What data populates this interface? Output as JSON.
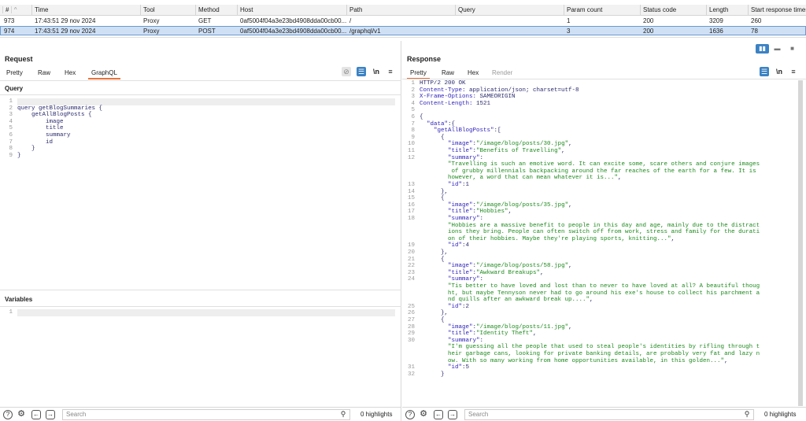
{
  "history": {
    "headers": [
      "#",
      "Time",
      "Tool",
      "Method",
      "Host",
      "Path",
      "Query",
      "Param count",
      "Status code",
      "Length",
      "Start response timer"
    ],
    "sort_indicator": "^",
    "rows": [
      {
        "num": "973",
        "time": "17:43:51 29 nov 2024",
        "tool": "Proxy",
        "method": "GET",
        "host": "0af5004f04a3e23bd4908dda00cb00...",
        "path": "/",
        "query": "",
        "params": "1",
        "status": "200",
        "length": "3209",
        "timer": "260"
      },
      {
        "num": "974",
        "time": "17:43:51 29 nov 2024",
        "tool": "Proxy",
        "method": "POST",
        "host": "0af5004f04a3e23bd4908dda00cb00...",
        "path": "/graphql/v1",
        "query": "",
        "params": "3",
        "status": "200",
        "length": "1636",
        "timer": "78"
      }
    ]
  },
  "request": {
    "title": "Request",
    "tabs": [
      "Pretty",
      "Raw",
      "Hex",
      "GraphQL"
    ],
    "active_tab": "GraphQL",
    "newline_label": "\\n",
    "query_label": "Query",
    "query_lines": [
      "",
      "query getBlogSummaries {",
      "    getAllBlogPosts {",
      "        image",
      "        title",
      "        summary",
      "        id",
      "    }",
      "}"
    ],
    "variables_label": "Variables",
    "variables_lines": [
      ""
    ]
  },
  "response": {
    "title": "Response",
    "tabs": [
      "Pretty",
      "Raw",
      "Hex",
      "Render"
    ],
    "active_tab": "Pretty",
    "newline_label": "\\n",
    "lines": [
      {
        "n": "1",
        "parts": [
          [
            "plain",
            "HTTP/2 200 OK"
          ]
        ]
      },
      {
        "n": "2",
        "parts": [
          [
            "key",
            "Content-Type: "
          ],
          [
            "plain",
            "application/json; charset=utf-8"
          ]
        ]
      },
      {
        "n": "3",
        "parts": [
          [
            "key",
            "X-Frame-Options: "
          ],
          [
            "plain",
            "SAMEORIGIN"
          ]
        ]
      },
      {
        "n": "4",
        "parts": [
          [
            "key",
            "Content-Length: "
          ],
          [
            "plain",
            "1521"
          ]
        ]
      },
      {
        "n": "5",
        "parts": [
          [
            "plain",
            ""
          ]
        ]
      },
      {
        "n": "6",
        "parts": [
          [
            "plain",
            "{"
          ]
        ]
      },
      {
        "n": "7",
        "parts": [
          [
            "plain",
            "  "
          ],
          [
            "key",
            "\"data\""
          ],
          [
            "plain",
            ":{"
          ]
        ]
      },
      {
        "n": "8",
        "parts": [
          [
            "plain",
            "    "
          ],
          [
            "key",
            "\"getAllBlogPosts\""
          ],
          [
            "plain",
            ":["
          ]
        ]
      },
      {
        "n": "9",
        "parts": [
          [
            "plain",
            "      {"
          ]
        ]
      },
      {
        "n": "10",
        "parts": [
          [
            "plain",
            "        "
          ],
          [
            "key",
            "\"image\""
          ],
          [
            "plain",
            ":"
          ],
          [
            "str",
            "\"/image/blog/posts/30.jpg\""
          ],
          [
            "plain",
            ","
          ]
        ]
      },
      {
        "n": "11",
        "parts": [
          [
            "plain",
            "        "
          ],
          [
            "key",
            "\"title\""
          ],
          [
            "plain",
            ":"
          ],
          [
            "str",
            "\"Benefits of Travelling\""
          ],
          [
            "plain",
            ","
          ]
        ]
      },
      {
        "n": "12",
        "parts": [
          [
            "plain",
            "        "
          ],
          [
            "key",
            "\"summary\""
          ],
          [
            "plain",
            ":"
          ]
        ]
      },
      {
        "n": "",
        "parts": [
          [
            "str",
            "        \"Travelling is such an emotive word. It can excite some, scare others and conjure images"
          ]
        ]
      },
      {
        "n": "",
        "parts": [
          [
            "str",
            "         of grubby millennials backpacking around the far reaches of the earth for a few. It is"
          ]
        ]
      },
      {
        "n": "",
        "parts": [
          [
            "str",
            "        however, a word that can mean whatever it is...\""
          ],
          [
            "plain",
            ","
          ]
        ]
      },
      {
        "n": "13",
        "parts": [
          [
            "plain",
            "        "
          ],
          [
            "key",
            "\"id\""
          ],
          [
            "plain",
            ":1"
          ]
        ]
      },
      {
        "n": "14",
        "parts": [
          [
            "plain",
            "      },"
          ]
        ]
      },
      {
        "n": "15",
        "parts": [
          [
            "plain",
            "      {"
          ]
        ]
      },
      {
        "n": "16",
        "parts": [
          [
            "plain",
            "        "
          ],
          [
            "key",
            "\"image\""
          ],
          [
            "plain",
            ":"
          ],
          [
            "str",
            "\"/image/blog/posts/35.jpg\""
          ],
          [
            "plain",
            ","
          ]
        ]
      },
      {
        "n": "17",
        "parts": [
          [
            "plain",
            "        "
          ],
          [
            "key",
            "\"title\""
          ],
          [
            "plain",
            ":"
          ],
          [
            "str",
            "\"Hobbies\""
          ],
          [
            "plain",
            ","
          ]
        ]
      },
      {
        "n": "18",
        "parts": [
          [
            "plain",
            "        "
          ],
          [
            "key",
            "\"summary\""
          ],
          [
            "plain",
            ":"
          ]
        ]
      },
      {
        "n": "",
        "parts": [
          [
            "str",
            "        \"Hobbies are a massive benefit to people in this day and age, mainly due to the distract"
          ]
        ]
      },
      {
        "n": "",
        "parts": [
          [
            "str",
            "        ions they bring. People can often switch off from work, stress and family for the durati"
          ]
        ]
      },
      {
        "n": "",
        "parts": [
          [
            "str",
            "        on of their hobbies. Maybe they're playing sports, knitting...\""
          ],
          [
            "plain",
            ","
          ]
        ]
      },
      {
        "n": "19",
        "parts": [
          [
            "plain",
            "        "
          ],
          [
            "key",
            "\"id\""
          ],
          [
            "plain",
            ":4"
          ]
        ]
      },
      {
        "n": "20",
        "parts": [
          [
            "plain",
            "      },"
          ]
        ]
      },
      {
        "n": "21",
        "parts": [
          [
            "plain",
            "      {"
          ]
        ]
      },
      {
        "n": "22",
        "parts": [
          [
            "plain",
            "        "
          ],
          [
            "key",
            "\"image\""
          ],
          [
            "plain",
            ":"
          ],
          [
            "str",
            "\"/image/blog/posts/58.jpg\""
          ],
          [
            "plain",
            ","
          ]
        ]
      },
      {
        "n": "23",
        "parts": [
          [
            "plain",
            "        "
          ],
          [
            "key",
            "\"title\""
          ],
          [
            "plain",
            ":"
          ],
          [
            "str",
            "\"Awkward Breakups\""
          ],
          [
            "plain",
            ","
          ]
        ]
      },
      {
        "n": "24",
        "parts": [
          [
            "plain",
            "        "
          ],
          [
            "key",
            "\"summary\""
          ],
          [
            "plain",
            ":"
          ]
        ]
      },
      {
        "n": "",
        "parts": [
          [
            "str",
            "        \"Tis better to have loved and lost than to never to have loved at all? A beautiful thoug"
          ]
        ]
      },
      {
        "n": "",
        "parts": [
          [
            "str",
            "        ht, but maybe Tennyson never had to go around his exe's house to collect his parchment a"
          ]
        ]
      },
      {
        "n": "",
        "parts": [
          [
            "str",
            "        nd quills after an awkward break up....\""
          ],
          [
            "plain",
            ","
          ]
        ]
      },
      {
        "n": "25",
        "parts": [
          [
            "plain",
            "        "
          ],
          [
            "key",
            "\"id\""
          ],
          [
            "plain",
            ":2"
          ]
        ]
      },
      {
        "n": "26",
        "parts": [
          [
            "plain",
            "      },"
          ]
        ]
      },
      {
        "n": "27",
        "parts": [
          [
            "plain",
            "      {"
          ]
        ]
      },
      {
        "n": "28",
        "parts": [
          [
            "plain",
            "        "
          ],
          [
            "key",
            "\"image\""
          ],
          [
            "plain",
            ":"
          ],
          [
            "str",
            "\"/image/blog/posts/11.jpg\""
          ],
          [
            "plain",
            ","
          ]
        ]
      },
      {
        "n": "29",
        "parts": [
          [
            "plain",
            "        "
          ],
          [
            "key",
            "\"title\""
          ],
          [
            "plain",
            ":"
          ],
          [
            "str",
            "\"Identity Theft\""
          ],
          [
            "plain",
            ","
          ]
        ]
      },
      {
        "n": "30",
        "parts": [
          [
            "plain",
            "        "
          ],
          [
            "key",
            "\"summary\""
          ],
          [
            "plain",
            ":"
          ]
        ]
      },
      {
        "n": "",
        "parts": [
          [
            "str",
            "        \"I'm guessing all the people that used to steal people's identities by rifling through t"
          ]
        ]
      },
      {
        "n": "",
        "parts": [
          [
            "str",
            "        heir garbage cans, looking for private banking details, are probably very fat and lazy n"
          ]
        ]
      },
      {
        "n": "",
        "parts": [
          [
            "str",
            "        ow. With so many working from home opportunities available, in this golden...\""
          ],
          [
            "plain",
            ","
          ]
        ]
      },
      {
        "n": "31",
        "parts": [
          [
            "plain",
            "        "
          ],
          [
            "key",
            "\"id\""
          ],
          [
            "plain",
            ":5"
          ]
        ]
      },
      {
        "n": "32",
        "parts": [
          [
            "plain",
            "      }"
          ]
        ]
      }
    ]
  },
  "footer": {
    "search_placeholder": "Search",
    "highlights": "0 highlights"
  },
  "colors": {
    "accent": "#e8743b",
    "selected_row": "#cfe0f5",
    "icon_blue": "#3b82c4",
    "json_key": "#2b1fb8",
    "json_string": "#1d8a1d"
  }
}
